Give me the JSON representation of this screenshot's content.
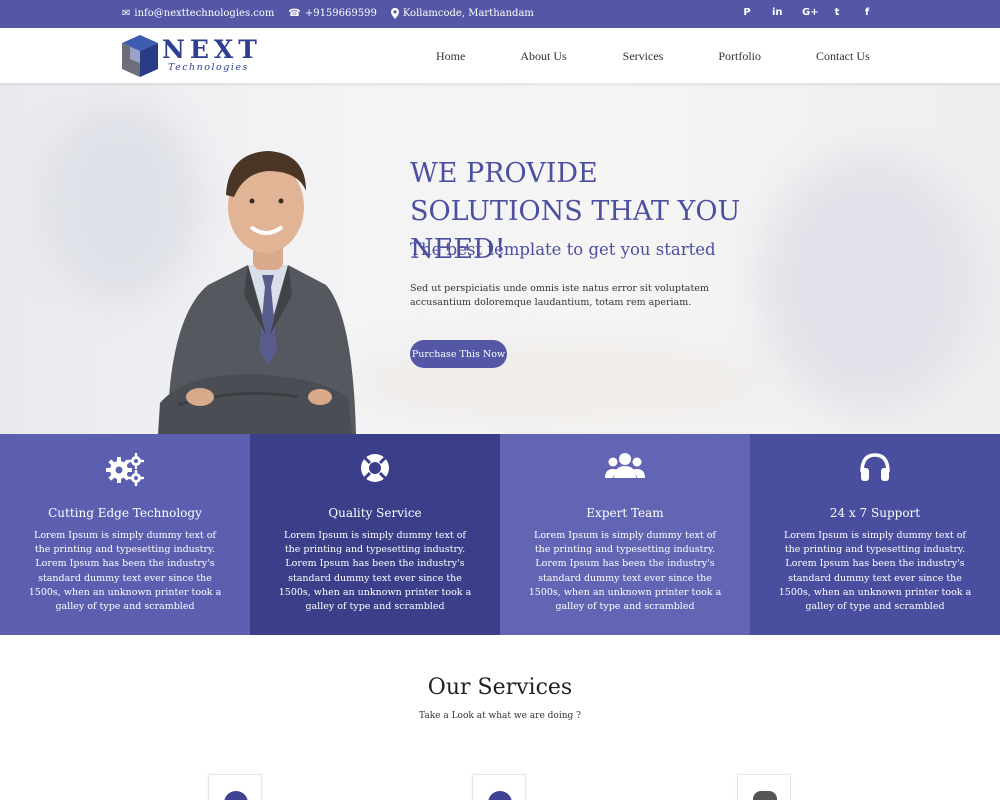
{
  "topbar": {
    "email": "info@nexttechnologies.com",
    "phone": "+9159669599",
    "location": "Kollamcode, Marthandam",
    "social": [
      {
        "name": "pinterest-icon",
        "glyph": "P"
      },
      {
        "name": "linkedin-icon",
        "glyph": "in"
      },
      {
        "name": "google-plus-icon",
        "glyph": "G+"
      },
      {
        "name": "twitter-icon",
        "glyph": "t"
      },
      {
        "name": "facebook-icon",
        "glyph": "f"
      }
    ]
  },
  "logo": {
    "brand": "NEXT",
    "sub": "Technologies"
  },
  "nav": [
    "Home",
    "About Us",
    "Services",
    "Portfolio",
    "Contact Us"
  ],
  "hero": {
    "headline": "WE PROVIDE SOLUTIONS THAT YOU NEED!",
    "subheadline": "The best template to get you started",
    "text": "Sed ut perspiciatis unde omnis iste natus error sit voluptatem accusantium doloremque laudantium, totam rem aperiam.",
    "button": "Purchase This Now"
  },
  "features": [
    {
      "icon": "gears-icon",
      "title": "Cutting Edge Technology",
      "desc": "Lorem Ipsum is simply dummy text of the printing and typesetting industry. Lorem Ipsum has been the industry's standard dummy text ever since the 1500s, when an unknown printer took a galley of type and scrambled",
      "color": "#5c5fb0"
    },
    {
      "icon": "life-ring-icon",
      "title": "Quality Service",
      "desc": "Lorem Ipsum is simply dummy text of the printing and typesetting industry. Lorem Ipsum has been the industry's standard dummy text ever since the 1500s, when an unknown printer took a galley of type and scrambled",
      "color": "#3b3f8a"
    },
    {
      "icon": "users-icon",
      "title": "Expert Team",
      "desc": "Lorem Ipsum is simply dummy text of the printing and typesetting industry. Lorem Ipsum has been the industry's standard dummy text ever since the 1500s, when an unknown printer took a galley of type and scrambled",
      "color": "#6265b4"
    },
    {
      "icon": "headphones-icon",
      "title": "24 x 7 Support",
      "desc": "Lorem Ipsum is simply dummy text of the printing and typesetting industry. Lorem Ipsum has been the industry's standard dummy text ever since the 1500s, when an unknown printer took a galley of type and scrambled",
      "color": "#4a4e9f"
    }
  ],
  "services": {
    "title": "Our Services",
    "subtitle": "Take a Look at what we are doing ?"
  },
  "colors": {
    "accent": "#5457a6",
    "headline": "#4b4fa0"
  }
}
